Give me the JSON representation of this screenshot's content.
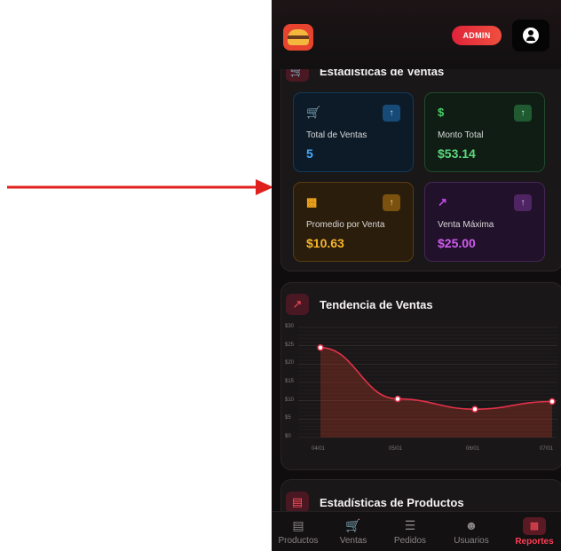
{
  "header": {
    "badge": "ADMIN",
    "logo_icon": "burger-icon",
    "user_icon": "user-circle-icon"
  },
  "sales_stats": {
    "title": "Estadísticas de Ventas",
    "icon": "cart-icon",
    "cards": [
      {
        "label": "Total de Ventas",
        "value": "5",
        "icon": "cart-icon",
        "symbol": "",
        "color": "#45a8ff"
      },
      {
        "label": "Monto Total",
        "value": "$53.14",
        "icon": "dollar-icon",
        "symbol": "$",
        "color": "#5bd87b"
      },
      {
        "label": "Promedio por Venta",
        "value": "$10.63",
        "icon": "bar-chart-icon",
        "symbol": "",
        "color": "#f7b52c"
      },
      {
        "label": "Venta Máxima",
        "value": "$25.00",
        "icon": "trend-icon",
        "symbol": "",
        "color": "#cf5cf0"
      }
    ]
  },
  "trend": {
    "title": "Tendencia de Ventas",
    "icon": "trend-icon"
  },
  "chart_data": {
    "type": "area",
    "categories": [
      "04/01",
      "05/01",
      "06/01",
      "07/01"
    ],
    "series": [
      {
        "values": [
          24.5,
          10.5,
          7.7,
          9.8
        ]
      }
    ],
    "y_ticks": [
      "$0",
      "$5",
      "$10",
      "$15",
      "$20",
      "$25",
      "$30"
    ],
    "ylim": [
      0,
      30
    ],
    "grid": true,
    "color": "#e2314a"
  },
  "products_stats": {
    "title": "Estadísticas de Productos",
    "icon": "box-icon"
  },
  "nav": [
    {
      "label": "Productos",
      "icon": "archive-icon"
    },
    {
      "label": "Ventas",
      "icon": "cart-icon"
    },
    {
      "label": "Pedidos",
      "icon": "clipboard-icon"
    },
    {
      "label": "Usuarios",
      "icon": "users-icon"
    },
    {
      "label": "Reportes",
      "icon": "report-chart-icon",
      "active": true
    }
  ]
}
